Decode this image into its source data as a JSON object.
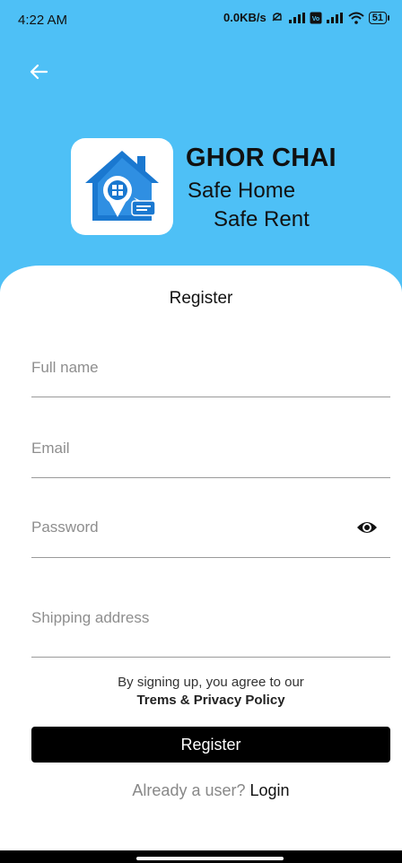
{
  "status_bar": {
    "time": "4:22 AM",
    "network_speed": "0.0KB/s",
    "battery": "51"
  },
  "header": {
    "back_icon": "arrow-left-icon",
    "brand": {
      "title": "GHOR CHAI",
      "tagline_line1": "Safe Home",
      "tagline_line2": "Safe Rent",
      "logo_icon": "house-location-pin-icon",
      "color": "#4ec0f6"
    }
  },
  "form": {
    "title": "Register",
    "fields": {
      "full_name": {
        "placeholder": "Full name",
        "value": ""
      },
      "email": {
        "placeholder": "Email",
        "value": ""
      },
      "password": {
        "placeholder": "Password",
        "value": "",
        "toggle_icon": "eye-icon"
      },
      "shipping_address": {
        "placeholder": "Shipping address",
        "value": ""
      }
    },
    "terms_prefix": "By signing up, you agree to our",
    "terms_link": "Trems & Privacy Policy",
    "submit_label": "Register",
    "login_prompt": "Already a user?",
    "login_link": "Login"
  }
}
